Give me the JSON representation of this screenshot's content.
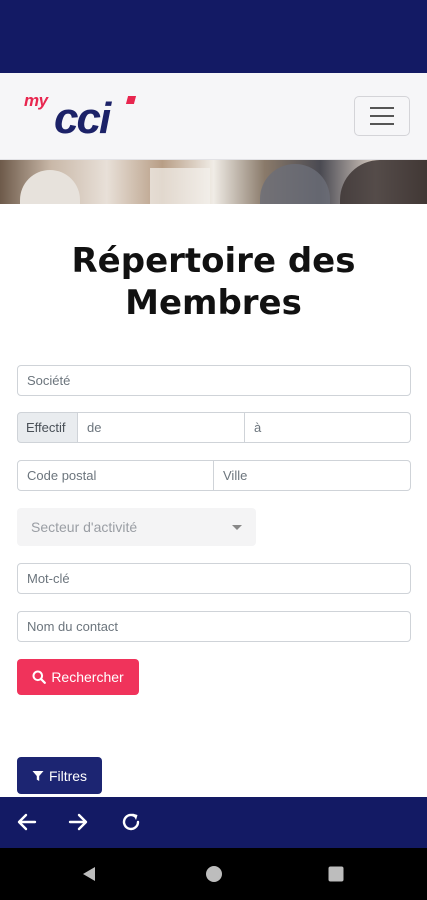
{
  "app": {
    "logo_prefix": "my",
    "logo_main": "cci"
  },
  "page": {
    "title": "Répertoire des Membres"
  },
  "form": {
    "societe_placeholder": "Société",
    "effectif_label": "Effectif",
    "effectif_from_placeholder": "de",
    "effectif_to_placeholder": "à",
    "code_postal_placeholder": "Code postal",
    "ville_placeholder": "Ville",
    "secteur_selected": "Secteur d'activité",
    "mot_cle_placeholder": "Mot-clé",
    "contact_placeholder": "Nom du contact",
    "search_label": "Rechercher",
    "filters_label": "Filtres"
  },
  "icons": {
    "menu": "hamburger-icon",
    "search": "search-icon",
    "filter": "filter-icon",
    "back": "arrow-left-icon",
    "forward": "arrow-right-icon",
    "reload": "reload-icon",
    "nav_back": "nav-back-icon",
    "nav_home": "nav-home-icon",
    "nav_recents": "nav-recents-icon"
  },
  "colors": {
    "brand_navy": "#131a64",
    "brand_red": "#f0335b",
    "filter_button": "#1c2572"
  }
}
